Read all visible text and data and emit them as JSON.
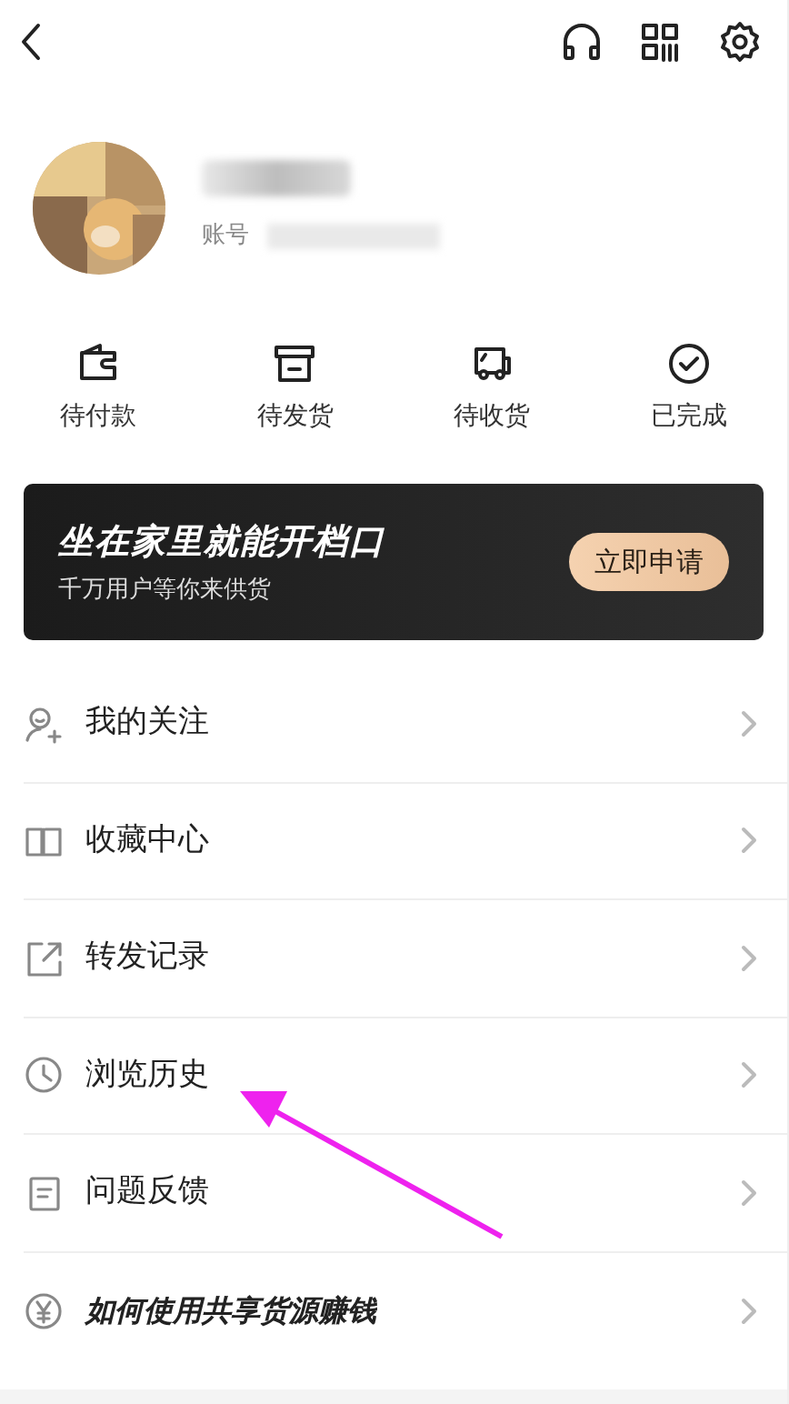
{
  "profile": {
    "account_label": "账号"
  },
  "orders": [
    {
      "label": "待付款"
    },
    {
      "label": "待发货"
    },
    {
      "label": "待收货"
    },
    {
      "label": "已完成"
    }
  ],
  "banner": {
    "title": "坐在家里就能开档口",
    "subtitle": "千万用户等你来供货",
    "button": "立即申请"
  },
  "menu": [
    {
      "label": "我的关注",
      "kind": "plain"
    },
    {
      "label": "收藏中心",
      "kind": "plain"
    },
    {
      "label": "转发记录",
      "kind": "plain"
    },
    {
      "label": "浏览历史",
      "kind": "plain"
    },
    {
      "label": "问题反馈",
      "kind": "plain"
    },
    {
      "label": "如何使用共享货源赚钱",
      "kind": "promo"
    }
  ]
}
